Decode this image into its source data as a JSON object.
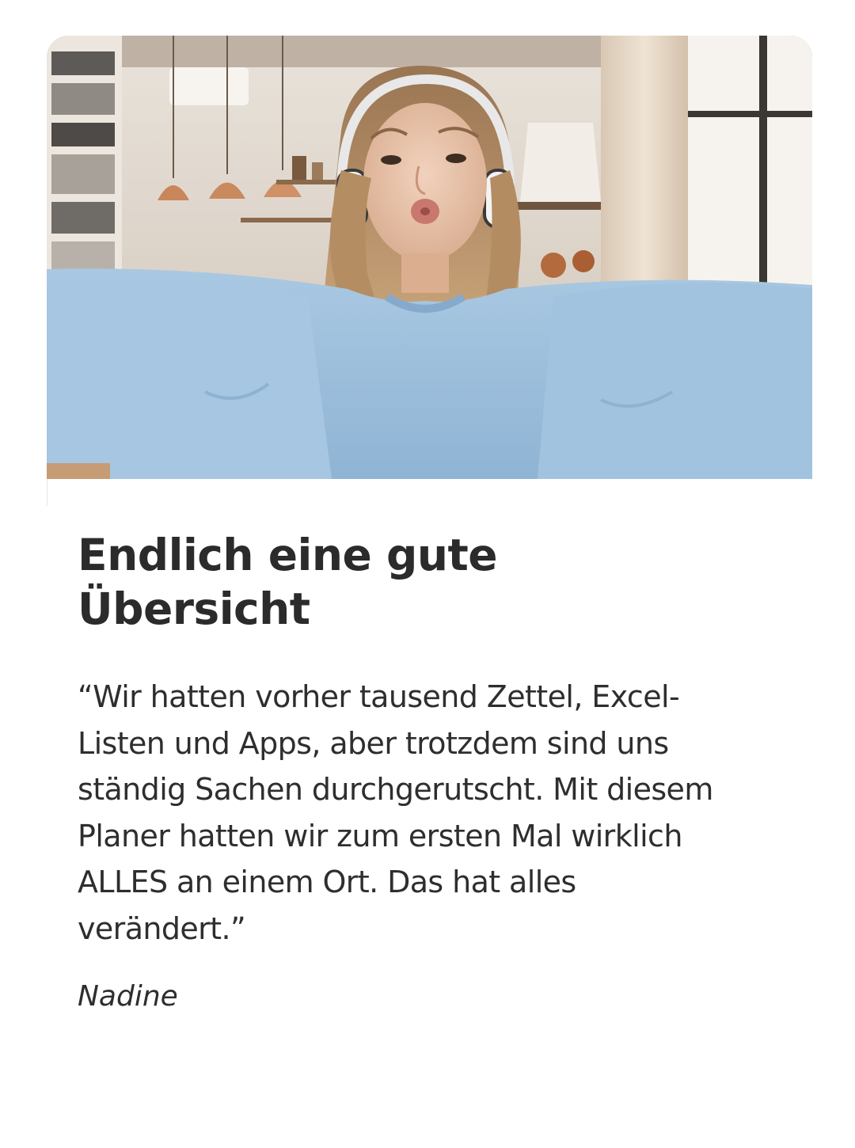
{
  "testimonial": {
    "image_alt": "",
    "title_lines": [
      "Endlich eine gute",
      "Übersicht"
    ],
    "quote_lines": [
      "“Wir hatten vorher tausend Zettel, Excel-",
      "Listen und Apps, aber trotzdem sind uns",
      "ständig Sachen durchgerutscht. Mit diesem",
      "Planer hatten wir zum ersten Mal wirklich",
      "ALLES an einem Ort. Das hat alles",
      "verändert.”"
    ],
    "author": "Nadine"
  },
  "colors": {
    "background": "#ffffff",
    "text": "#2b2b2b",
    "sweater": "#9fc1dd"
  }
}
